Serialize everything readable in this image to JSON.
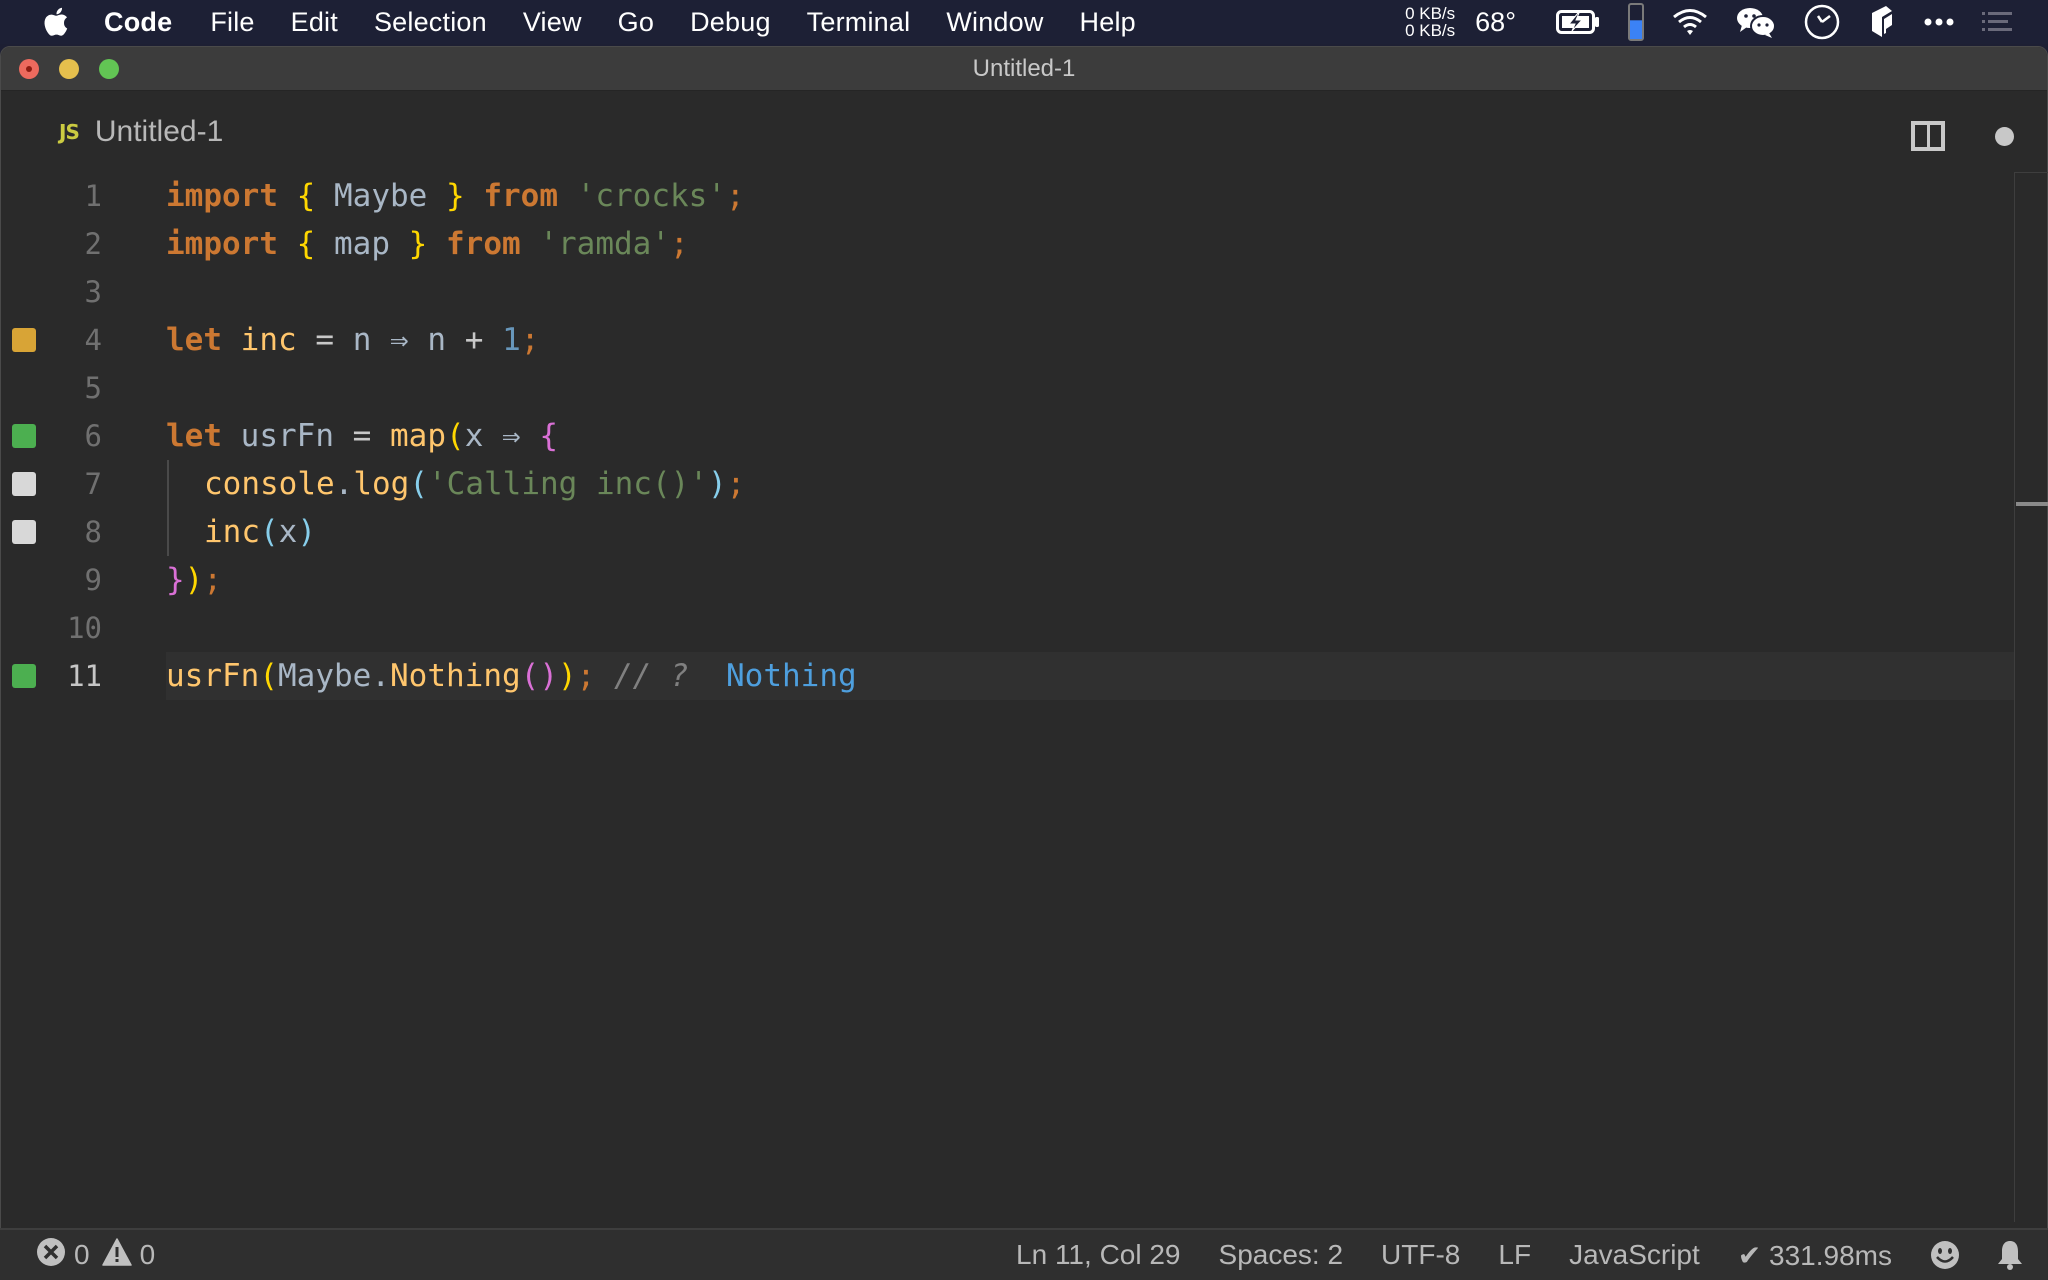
{
  "menubar": {
    "app_name": "Code",
    "items": [
      "File",
      "Edit",
      "Selection",
      "View",
      "Go",
      "Debug",
      "Terminal",
      "Window",
      "Help"
    ],
    "net_up": "0 KB/s",
    "net_down": "0 KB/s",
    "temperature": "68°",
    "tray_icons": [
      "battery-charging-icon",
      "memory-gauge-icon",
      "wifi-icon",
      "wechat-icon",
      "clock-icon",
      "app-cube-icon",
      "more-icon",
      "list-icon"
    ],
    "memory_fill_percent": 55
  },
  "window": {
    "title": "Untitled-1"
  },
  "tab": {
    "language_badge": "JS",
    "label": "Untitled-1",
    "dirty": true
  },
  "editor": {
    "lines": [
      {
        "n": "1",
        "marker": null
      },
      {
        "n": "2",
        "marker": null
      },
      {
        "n": "3",
        "marker": null
      },
      {
        "n": "4",
        "marker": "yellow"
      },
      {
        "n": "5",
        "marker": null
      },
      {
        "n": "6",
        "marker": "green"
      },
      {
        "n": "7",
        "marker": "grey"
      },
      {
        "n": "8",
        "marker": "grey"
      },
      {
        "n": "9",
        "marker": null
      },
      {
        "n": "10",
        "marker": null
      },
      {
        "n": "11",
        "marker": "green"
      }
    ],
    "tokens": {
      "l1": [
        "import",
        "{",
        "Maybe",
        "}",
        "from",
        "'crocks'",
        ";"
      ],
      "l2": [
        "import",
        "{",
        "map",
        "}",
        "from",
        "'ramda'",
        ";"
      ],
      "l4": [
        "let",
        "inc",
        "=",
        "n",
        "⇒",
        "n",
        "+",
        "1",
        ";"
      ],
      "l6": [
        "let",
        "usrFn",
        "=",
        "map",
        "(",
        "x",
        "⇒",
        "{"
      ],
      "l7": [
        "console",
        ".",
        "log",
        "(",
        "'Calling inc()'",
        ")",
        ";"
      ],
      "l8": [
        "inc",
        "(",
        "x",
        ")"
      ],
      "l9": [
        "}",
        ")",
        ";"
      ],
      "l11": [
        "usrFn",
        "(",
        "Maybe",
        ".",
        "Nothing",
        "(",
        ")",
        ")",
        ";",
        "// ?",
        "Nothing"
      ]
    },
    "current_line": 11
  },
  "statusbar": {
    "errors": "0",
    "warnings": "0",
    "cursor": "Ln 11, Col 29",
    "indent": "Spaces: 2",
    "encoding": "UTF-8",
    "eol": "LF",
    "language": "JavaScript",
    "timing": "✔ 331.98ms"
  },
  "colors": {
    "keyword": "#cc7832",
    "string": "#6a8759",
    "number": "#6897bb",
    "function": "#ffc66d",
    "bracket_1": "#ffd700",
    "bracket_2": "#da70d6",
    "bracket_3": "#87ceeb",
    "result": "#4e9fde",
    "marker_yellow": "#d8a436",
    "marker_green": "#4caf50",
    "marker_grey": "#d8d8d8"
  }
}
